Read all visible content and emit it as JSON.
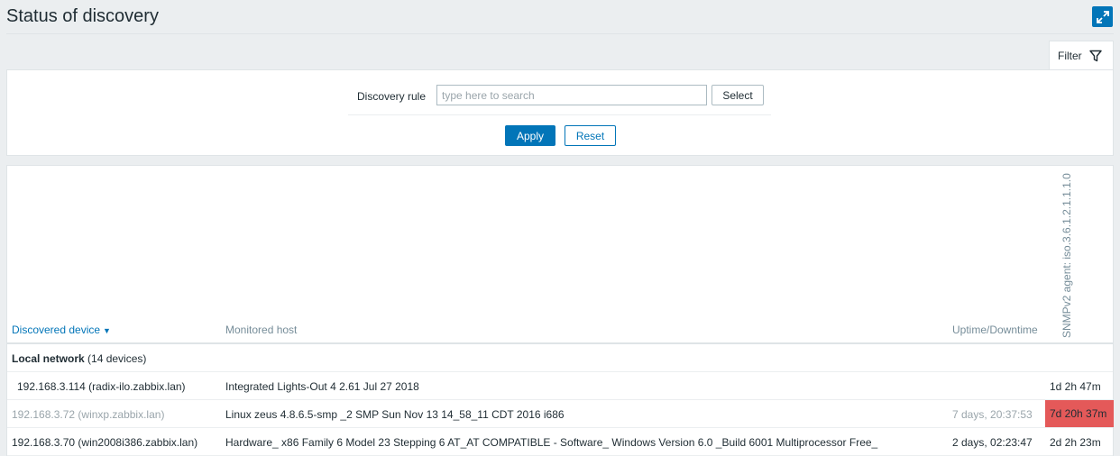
{
  "page": {
    "title": "Status of discovery"
  },
  "header": {
    "fullscreen_icon": "fullscreen-expand-icon"
  },
  "filter": {
    "tab_label": "Filter",
    "tab_icon": "funnel-icon",
    "discovery_rule_label": "Discovery rule",
    "discovery_rule_placeholder": "type here to search",
    "discovery_rule_value": "",
    "select_label": "Select",
    "apply_label": "Apply",
    "reset_label": "Reset"
  },
  "table": {
    "columns": {
      "device": "Discovered device",
      "device_sort_icon": "sort-down-icon",
      "host": "Monitored host",
      "uptime": "Uptime/Downtime",
      "check": "SNMPv2 agent: iso.3.6.1.2.1.1.1.0"
    },
    "group": {
      "name": "Local network",
      "count": "(14 devices)"
    },
    "rows": [
      {
        "device": "192.168.3.114 (radix-ilo.zabbix.lan)",
        "host": "Integrated Lights-Out 4 2.61 Jul 27 2018",
        "uptime": "",
        "check": "1d 2h 47m",
        "status": "up"
      },
      {
        "device": "192.168.3.72 (winxp.zabbix.lan)",
        "host": "Linux zeus 4.8.6.5-smp _2 SMP Sun Nov 13 14_58_11 CDT 2016 i686",
        "uptime": "7 days, 20:37:53",
        "check": "7d 20h 37m",
        "status": "down"
      },
      {
        "device": "192.168.3.70 (win2008i386.zabbix.lan)",
        "host": "Hardware_ x86 Family 6 Model 23 Stepping 6 AT_AT COMPATIBLE - Software_ Windows Version 6.0 _Build 6001 Multiprocessor Free_",
        "uptime": "2 days, 02:23:47",
        "check": "2d 2h 23m",
        "status": "up"
      }
    ]
  },
  "colors": {
    "accent": "#0275b8",
    "down": "#e45959",
    "disabled_text": "#9aa5ab"
  }
}
